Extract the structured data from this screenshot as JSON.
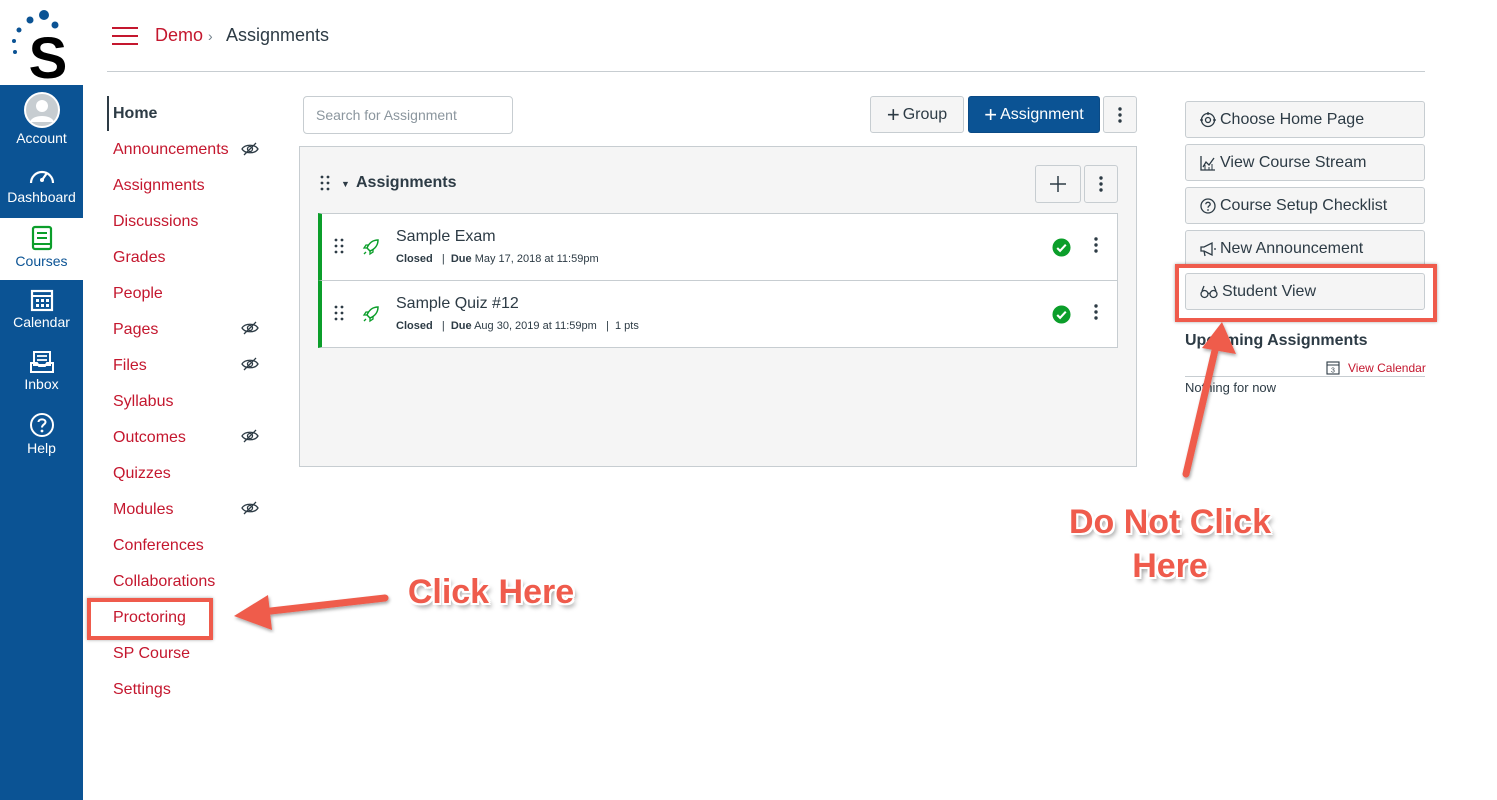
{
  "global_nav": {
    "items": [
      {
        "label": "Account",
        "icon": "account-icon"
      },
      {
        "label": "Dashboard",
        "icon": "dashboard-icon"
      },
      {
        "label": "Courses",
        "icon": "courses-icon",
        "active": true
      },
      {
        "label": "Calendar",
        "icon": "calendar-icon"
      },
      {
        "label": "Inbox",
        "icon": "inbox-icon"
      },
      {
        "label": "Help",
        "icon": "help-icon"
      }
    ],
    "brand_color": "#0b5394"
  },
  "breadcrumb": {
    "course": "Demo",
    "separator": "›",
    "current": "Assignments"
  },
  "course_nav": {
    "items": [
      {
        "label": "Home",
        "active": true
      },
      {
        "label": "Announcements",
        "hidden": true
      },
      {
        "label": "Assignments"
      },
      {
        "label": "Discussions"
      },
      {
        "label": "Grades"
      },
      {
        "label": "People"
      },
      {
        "label": "Pages",
        "hidden": true
      },
      {
        "label": "Files",
        "hidden": true
      },
      {
        "label": "Syllabus"
      },
      {
        "label": "Outcomes",
        "hidden": true
      },
      {
        "label": "Quizzes"
      },
      {
        "label": "Modules",
        "hidden": true
      },
      {
        "label": "Conferences"
      },
      {
        "label": "Collaborations"
      },
      {
        "label": "Proctoring"
      },
      {
        "label": "SP Course"
      },
      {
        "label": "Settings"
      }
    ],
    "link_color": "#c4172e"
  },
  "toolbar": {
    "search_placeholder": "Search for Assignment",
    "group_label": "Group",
    "assignment_label": "Assignment"
  },
  "assignment_group": {
    "title": "Assignments",
    "items": [
      {
        "title": "Sample Exam",
        "status": "Closed",
        "due_label": "Due",
        "due": "May 17, 2018 at 11:59pm",
        "points": ""
      },
      {
        "title": "Sample Quiz #12",
        "status": "Closed",
        "due_label": "Due",
        "due": "Aug 30, 2019 at 11:59pm",
        "points": "1 pts"
      }
    ]
  },
  "sidebar": {
    "buttons": [
      {
        "label": "Choose Home Page",
        "icon": "target-icon"
      },
      {
        "label": "View Course Stream",
        "icon": "stream-icon"
      },
      {
        "label": "Course Setup Checklist",
        "icon": "question-icon"
      },
      {
        "label": "New Announcement",
        "icon": "megaphone-icon"
      },
      {
        "label": "Student View",
        "icon": "glasses-icon"
      }
    ],
    "upcoming_title": "Upcoming Assignments",
    "view_calendar": "View Calendar",
    "calendar_day": "3",
    "empty_text": "Nothing for now"
  },
  "annotations": {
    "click_here": "Click Here",
    "do_not_click_line1": "Do Not Click",
    "do_not_click_line2": "Here",
    "color": "#ef5b4c"
  }
}
